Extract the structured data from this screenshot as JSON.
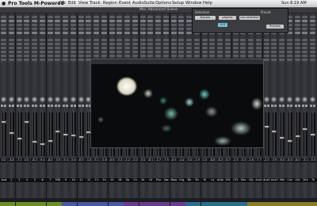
{
  "menubar": {
    "apple": "",
    "app_name": "Pro Tools M-Powered",
    "menus": [
      "File",
      "Edit",
      "View",
      "Track",
      "Region",
      "Event",
      "AudioSuite",
      "Options",
      "Setup",
      "Window",
      "Help"
    ],
    "status": "Sun 8:19 AM"
  },
  "session": {
    "title": "Mix: Advanced Scene"
  },
  "plugin": {
    "selection_label": "Selection",
    "preset_label": "Preset",
    "btn1": "Bypass",
    "btn2": "playlist",
    "btn3": "use selection",
    "value": "0.0",
    "process": "Process"
  },
  "video": {
    "title": ""
  },
  "strips": [
    {
      "name": "Aud",
      "readout": "0.0",
      "color": "#6a8f2a"
    },
    {
      "name": "2",
      "readout": "-4.8",
      "color": "#6a8f2a"
    },
    {
      "name": "3",
      "readout": "-7.1",
      "color": "#6a8f2a"
    },
    {
      "name": "4",
      "readout": "0.0",
      "color": "#6a8f2a"
    },
    {
      "name": "5",
      "readout": "-8.2",
      "color": "#6a8f2a"
    },
    {
      "name": "6",
      "readout": "-9.4",
      "color": "#6a8f2a"
    },
    {
      "name": "7",
      "readout": "-8.0",
      "color": "#6a8f2a"
    },
    {
      "name": "MID",
      "readout": "-3.9",
      "color": "#6a8f2a"
    },
    {
      "name": "9",
      "readout": "-5.4",
      "color": "#4a5aa0"
    },
    {
      "name": "10",
      "readout": "-5.6",
      "color": "#4a5aa0"
    },
    {
      "name": "11",
      "readout": "-6.3",
      "color": "#4a5aa0"
    },
    {
      "name": "12",
      "readout": "-4.4",
      "color": "#4a5aa0"
    },
    {
      "name": "13",
      "readout": "-5.1",
      "color": "#4a5aa0"
    },
    {
      "name": "14",
      "readout": "-5.8",
      "color": "#4a5aa0"
    },
    {
      "name": "15",
      "readout": "-6.6",
      "color": "#4a5aa0"
    },
    {
      "name": "16",
      "readout": "-3.2",
      "color": "#4a5aa0"
    },
    {
      "name": "Sp",
      "readout": "-4.2",
      "color": "#6b3c8a"
    },
    {
      "name": "Ch",
      "readout": "-4.0",
      "color": "#6b3c8a"
    },
    {
      "name": "Dr",
      "readout": "-5.0",
      "color": "#6b3c8a"
    },
    {
      "name": "Gt",
      "readout": "-6.1",
      "color": "#6b3c8a"
    },
    {
      "name": "Pno",
      "readout": "-2.7",
      "color": "#6b3c8a"
    },
    {
      "name": "Vox",
      "readout": "-7.9",
      "color": "#6b3c8a"
    },
    {
      "name": "Bass",
      "readout": "-6.3",
      "color": "#6b3c8a"
    },
    {
      "name": "Org",
      "readout": "-4.4",
      "color": "#6b3c8a"
    },
    {
      "name": "Bk",
      "readout": "-3.5",
      "color": "#2c6e8c"
    },
    {
      "name": "Str",
      "readout": "-1.9",
      "color": "#2c6e8c"
    },
    {
      "name": "Hi",
      "readout": "0.0",
      "color": "#2c6e8c"
    },
    {
      "name": "Lo",
      "readout": "-8.8",
      "color": "#2c6e8c"
    },
    {
      "name": "Amb",
      "readout": "-8.4",
      "color": "#2c6e8c"
    },
    {
      "name": "FX1",
      "readout": "-6.7",
      "color": "#2c6e8c"
    },
    {
      "name": "FX2",
      "readout": "-2.5",
      "color": "#2c6e8c"
    },
    {
      "name": "Rev",
      "readout": "-5.3",
      "color": "#2c6e8c"
    },
    {
      "name": "Dly",
      "readout": "-2.6",
      "color": "#8a7b2a"
    },
    {
      "name": "Aux1",
      "readout": "-7.7",
      "color": "#8a7b2a"
    },
    {
      "name": "Aux2",
      "readout": "-2.0",
      "color": "#8a7b2a"
    },
    {
      "name": "Aux3",
      "readout": "-3.9",
      "color": "#8a7b2a"
    },
    {
      "name": "Mst",
      "readout": "-6.5",
      "color": "#8a7b2a"
    },
    {
      "name": "Cue",
      "readout": "-8.0",
      "color": "#8a7b2a"
    },
    {
      "name": "Out",
      "readout": "-6.0",
      "color": "#8a7b2a"
    },
    {
      "name": "2trk",
      "readout": "-3.1",
      "color": "#8a7b2a"
    },
    {
      "name": "Tk",
      "readout": "-5.3",
      "color": "#8a7b2a"
    }
  ]
}
